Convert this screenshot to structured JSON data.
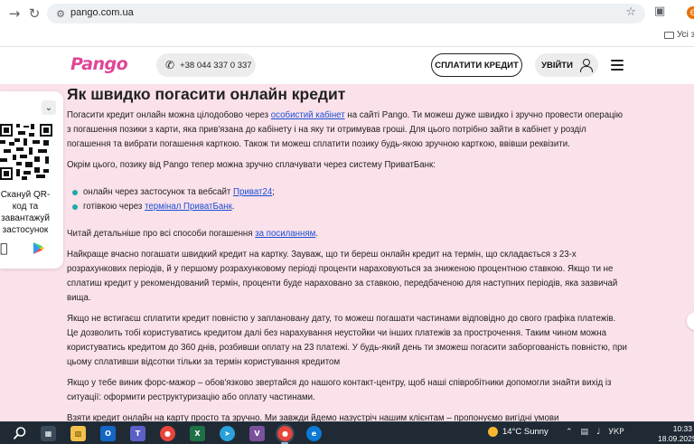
{
  "browser": {
    "url": "pango.com.ua",
    "bookmarks_folder": "Усі за",
    "profile_initial": "Є"
  },
  "header": {
    "logo": "Pango",
    "phone": "+38 044 337 0 337",
    "pay_button": "СПЛАТИТИ КРЕДИТ",
    "login_button": "УВІЙТИ"
  },
  "qr_panel": {
    "caption": "Скануй QR-код та завантажуй застосунок"
  },
  "article": {
    "title": "Як швидко погасити онлайн кредит",
    "p1_a": "Погасити кредит онлайн можна цілодобово через ",
    "p1_link": "особистий кабінет",
    "p1_b": " на сайті Pango. Ти можеш дуже швидко і зручно провести операцію з погашення позики з карти, яка прив'язана до кабінету і на яку ти отримував гроші. Для цього потрібно зайти в кабінет у розділ погашення та вибрати погашення карткою. Також ти можеш сплатити позику будь-якою зручною карткою, ввівши реквізити.",
    "p2": "Окрім цього, позику від Pango тепер можна зручно сплачувати через систему ПриватБанк:",
    "li1_a": "онлайн через застосунок та вебсайт ",
    "li1_link": "Приват24",
    "li1_b": ";",
    "li2_a": "готівкою через ",
    "li2_link": "термінал ПриватБанк",
    "li2_b": ".",
    "p3_a": "Читай детальніше про всі способи погашення ",
    "p3_link": "за посиланням",
    "p3_b": ".",
    "p4": "Найкраще вчасно погашати швидкий кредит на картку. Зауваж, що ти береш онлайн кредит на термін, що складається з 23-х розрахункових періодів, й у першому розрахунковому періоді проценти нараховуються за зниженою процентною ставкою. Якщо ти не сплатиш кредит у рекомендований термін, проценти буде нараховано за ставкою, передбаченою для наступних періодів, яка зазвичай вища.",
    "p5": "Якщо не встигаєш сплатити кредит повністю у заплановану дату, то можеш погашати частинами відповідно до свого графіка платежів. Це дозволить тобі користуватись кредитом далі без нарахування неустойки чи інших платежів за прострочення. Таким чином можна користуватись кредитом до 360 днів, розбивши оплату на 23 платежі. У будь-який день ти зможеш погасити заборгованість повністю, при цьому сплативши відсотки тільки за термін користування кредитом",
    "p6": "Якщо у тебе виник форс-мажор – обов'язково звертайся до нашого контакт-центру, щоб наші співробітники допомогли знайти вихід із ситуації: оформити реструктуризацію або оплату частинами.",
    "p7": "Взяти кредит онлайн на карту просто та зручно. Ми завжди йдемо назустріч нашим клієнтам – пропонуємо вигідні умови"
  },
  "taskbar": {
    "weather": "14°C  Sunny",
    "language": "УКР",
    "time": "10:33",
    "date": "18.09.2025",
    "badge_outlook": "2",
    "badge_viber": "1"
  }
}
